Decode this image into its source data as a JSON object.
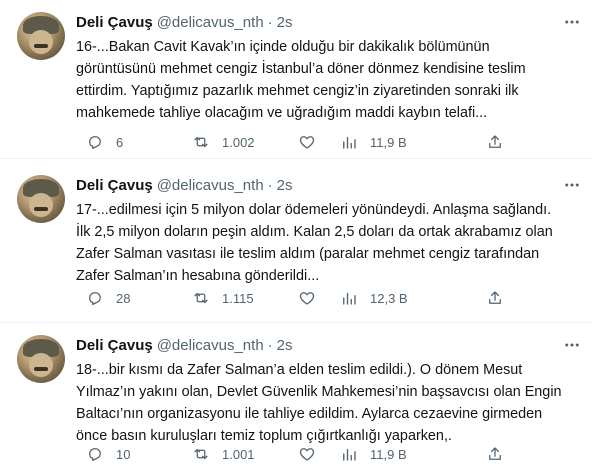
{
  "tweets": [
    {
      "name": "Deli Çavuş",
      "handle": "@delicavus_nth",
      "separator": "·",
      "time": "2s",
      "text": "16-...Bakan Cavit Kavak’ın içinde olduğu bir dakikalık bölümünün\ngörüntüsünü mehmet cengiz İstanbul’a döner dönmez kendisine teslim\nettirdim. Yaptığımız pazarlık mehmet cengiz’in ziyaretinden sonraki ilk\nmahkemede tahliye olacağım ve uğradığım maddi kaybın telafi...",
      "replies": "6",
      "retweets": "1.002",
      "likes": "",
      "views": "11,9 B"
    },
    {
      "name": "Deli Çavuş",
      "handle": "@delicavus_nth",
      "separator": "·",
      "time": "2s",
      "text": "17-...edilmesi için 5 milyon dolar ödemeleri yönündeydi. Anlaşma sağlandı.\nİlk 2,5 milyon doların peşin aldım. Kalan 2,5 doları da ortak akrabamız olan\nZafer Salman vasıtası ile teslim aldım (paralar mehmet cengiz tarafından\nZafer Salman’ın hesabına gönderildi...",
      "replies": "28",
      "retweets": "1.115",
      "likes": "",
      "views": "12,3 B"
    },
    {
      "name": "Deli Çavuş",
      "handle": "@delicavus_nth",
      "separator": "·",
      "time": "2s",
      "text": "18-...bir kısmı da Zafer Salman’a elden teslim edildi.). O dönem Mesut\nYılmaz’ın yakını olan, Devlet Güvenlik Mahkemesi’nin başsavcısı olan Engin\nBaltacı’nın organizasyonu ile tahliye edildim. Aylarca cezaevine girmeden\nönce basın kuruluşları temiz toplum çığırtkanlığı yaparken,.",
      "replies": "10",
      "retweets": "1.001",
      "likes": "",
      "views": "11,9 B"
    }
  ],
  "icons": [
    "more-icon",
    "reply-icon",
    "retweet-icon",
    "like-icon",
    "views-icon",
    "share-icon"
  ],
  "colors": {
    "text": "#0f1419",
    "muted": "#536471",
    "divider": "#eff3f4"
  }
}
